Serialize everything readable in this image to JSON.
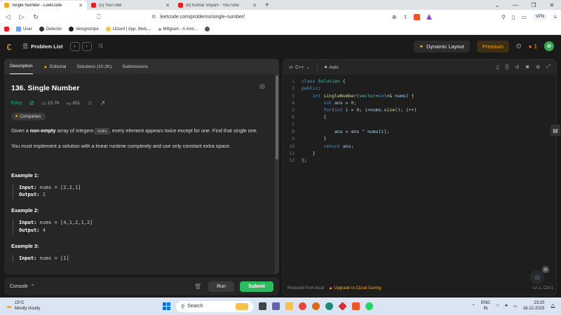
{
  "browser": {
    "tabs": [
      {
        "title": "Single Number - LeetCode",
        "color": "#f5a623",
        "active": true
      },
      {
        "title": "(5) YouTube",
        "color": "#e62117",
        "active": false
      },
      {
        "title": "(8) Kumar Shyam - YouTube",
        "color": "#e62117",
        "active": false
      }
    ],
    "new_tab": "+",
    "url": "leetcode.com/problems/single-number/",
    "vpn": "VPN",
    "bookmarks": [
      {
        "label": "",
        "color": "#e62117"
      },
      {
        "label": "User",
        "color": "#6aa0ff"
      },
      {
        "label": "Detector",
        "color": "#333333"
      },
      {
        "label": "designstripe",
        "color": "#222222"
      },
      {
        "label": "Uizard | App, Web,...",
        "color": "#f5c542"
      },
      {
        "label": "Millgram - A mini...",
        "color": "#999999"
      },
      {
        "label": "",
        "color": "#555555"
      }
    ]
  },
  "header": {
    "problem_list": "Problem List",
    "dynamic_layout": "Dynamic Layout",
    "premium": "Premium",
    "streak": "1"
  },
  "left": {
    "tabs": [
      "Description",
      "Editorial",
      "Solutions (10.2K)",
      "Submissions"
    ],
    "title": "136. Single Number",
    "difficulty": "Easy",
    "likes": "15.7K",
    "dislikes": "651",
    "companies": "Companies",
    "desc_a": "Given a ",
    "desc_bold": "non-empty",
    "desc_b": " array of integers ",
    "desc_code": "nums",
    "desc_c": ", every element appears twice except for one. Find that single one.",
    "desc2": "You must implement a solution with a linear runtime complexity and use only constant extra space.",
    "examples": [
      {
        "title": "Example 1:",
        "input": "nums = [2,2,1]",
        "output": "1"
      },
      {
        "title": "Example 2:",
        "input": "nums = [4,1,2,1,2]",
        "output": "4"
      },
      {
        "title": "Example 3:",
        "input": "nums = [1]",
        "output": ""
      }
    ],
    "input_label": "Input:",
    "output_label": "Output:"
  },
  "console": {
    "label": "Console",
    "run": "Run",
    "submit": "Submit"
  },
  "editor": {
    "language": "C++",
    "mode": "Auto",
    "line_numbers": [
      "1",
      "2",
      "3",
      "4",
      "5",
      "6",
      "7",
      "8",
      "9",
      "10",
      "11",
      "12"
    ],
    "footer_left": "Restored from local",
    "footer_upgrade": "Upgrade to Cloud Saving",
    "cursor": "Ln 1, Col 1"
  },
  "taskbar": {
    "temp": "15°C",
    "weather": "Mostly cloudy",
    "search": "Search",
    "lang1": "ENG",
    "lang2": "IN",
    "time": "23:20",
    "date": "18-12-2023"
  }
}
